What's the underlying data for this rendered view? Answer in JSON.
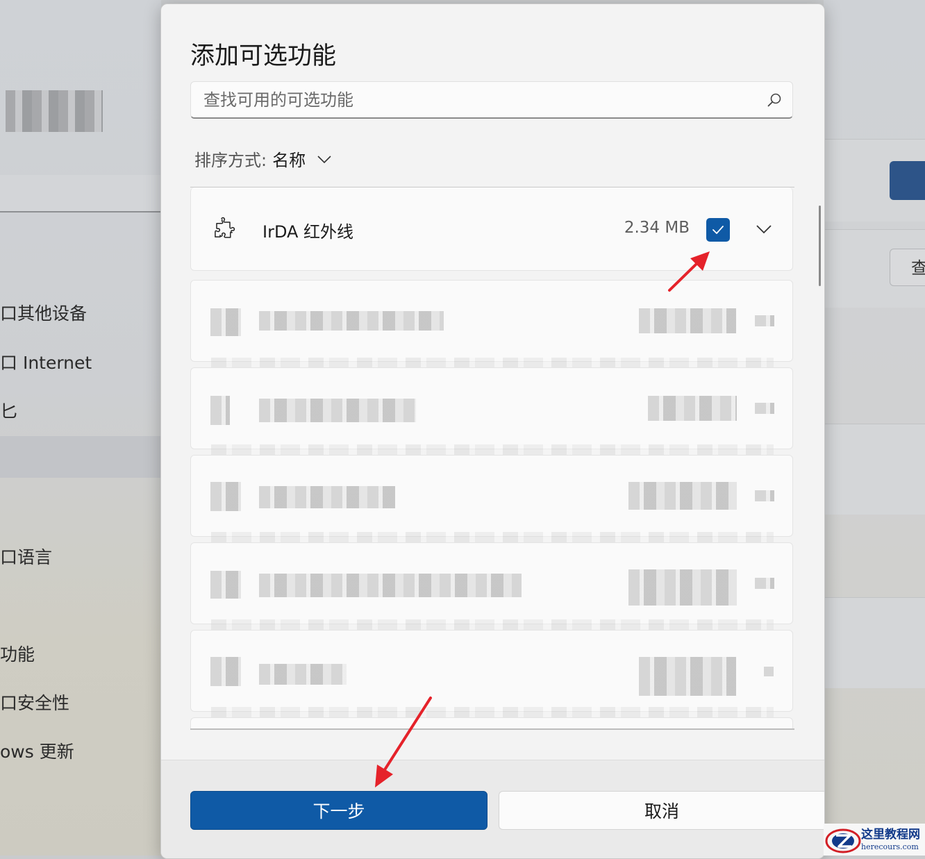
{
  "background": {
    "nav_items": [
      "口其他设备",
      "口 Internet",
      "匕",
      "口语言",
      "功能",
      "口安全性",
      "ows 更新"
    ],
    "right_button_char": "查"
  },
  "dialog": {
    "title": "添加可选功能",
    "search": {
      "placeholder": "查找可用的可选功能",
      "value": ""
    },
    "sort": {
      "label": "排序方式:",
      "value": "名称"
    },
    "features": [
      {
        "name": "IrDA 红外线",
        "size": "2.34 MB",
        "checked": true,
        "icon": "puzzle-icon"
      }
    ],
    "buttons": {
      "next": "下一步",
      "cancel": "取消"
    }
  },
  "colors": {
    "accent": "#0f5aa6",
    "annotation_arrow": "#e5222a"
  },
  "watermark": {
    "cn": "这里教程网",
    "en": "herecours.com"
  }
}
